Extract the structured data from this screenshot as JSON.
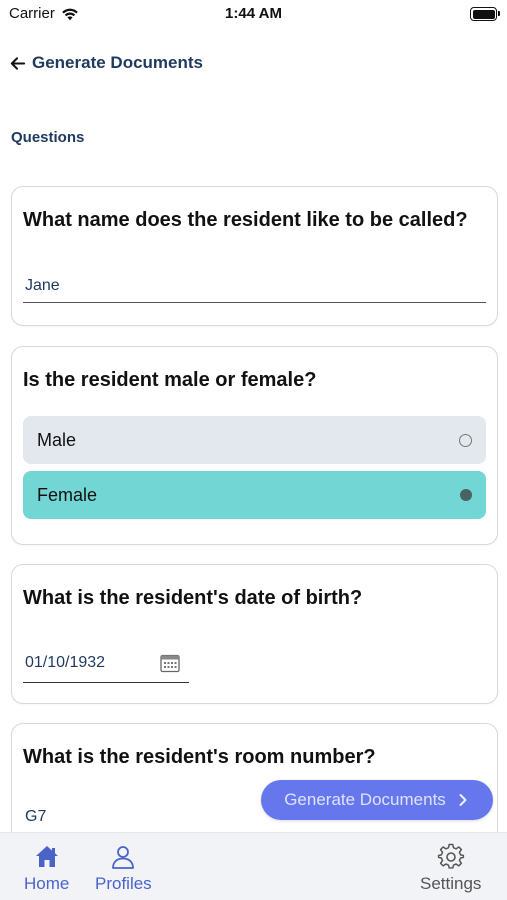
{
  "status_bar": {
    "carrier": "Carrier",
    "time": "1:44 AM",
    "wifi_icon": "wifi-icon",
    "battery_icon": "battery-icon"
  },
  "header": {
    "back_icon": "arrow-left-icon",
    "title": "Generate Documents"
  },
  "section": {
    "title": "Questions"
  },
  "questions": [
    {
      "text": "What name does the resident like to be called?",
      "type": "text",
      "value": "Jane"
    },
    {
      "text": "Is the resident male or female?",
      "type": "radio",
      "options": [
        {
          "label": "Male",
          "selected": false
        },
        {
          "label": "Female",
          "selected": true
        }
      ]
    },
    {
      "text": "What is the resident's date of birth?",
      "type": "date",
      "value": "01/10/1932",
      "icon": "calendar-icon"
    },
    {
      "text": "What is the resident's room number?",
      "type": "text",
      "value": "G7"
    }
  ],
  "action_button": {
    "label": "Generate Documents",
    "icon": "chevron-right-icon"
  },
  "tab_bar": {
    "items": [
      {
        "label": "Home",
        "icon": "home-icon"
      },
      {
        "label": "Profiles",
        "icon": "person-icon"
      },
      {
        "label": "Settings",
        "icon": "gear-icon"
      }
    ]
  },
  "colors": {
    "accent": "#6677ee",
    "selected_option": "#72d6d4",
    "unselected_option": "#e3e7ee",
    "header_text": "#1f3a5f",
    "tab_active": "#4a63c9"
  }
}
